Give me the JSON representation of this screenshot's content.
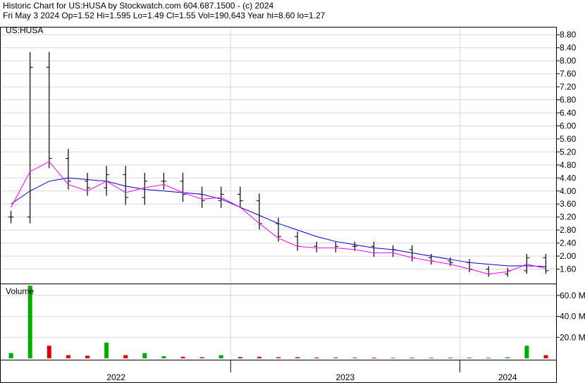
{
  "header": {
    "line1": "Historic Chart for US:HUSA by Stockwatch.com 604.687.1500 - (c) 2024",
    "line2": "Fri May  3 2024  Op=1.52  Hi=1.595  Lo=1.49  Cl=1.55  Vol=190,643  Year hi=8.60  lo=1.27"
  },
  "colors": {
    "price_bar": "#000000",
    "ma_short": "#ff00ff",
    "ma_long": "#0000cc",
    "volume_up": "#00aa00",
    "volume_down": "#dd0000",
    "grid": "#d8d8d8"
  },
  "chart_data": [
    {
      "type": "ohlc",
      "title": "US:HUSA",
      "ylim": [
        1.2,
        9.0
      ],
      "y_ticks": [
        "8.80",
        "8.40",
        "8.00",
        "7.60",
        "7.20",
        "6.80",
        "6.40",
        "6.00",
        "5.60",
        "5.20",
        "4.80",
        "4.40",
        "4.00",
        "3.60",
        "3.20",
        "2.80",
        "2.40",
        "2.00",
        "1.60"
      ],
      "x_ticks": [
        "2022",
        "2023",
        "2024"
      ],
      "grid": true,
      "series": [
        {
          "type": "price",
          "x": [
            "2022-01",
            "2022-02",
            "2022-03",
            "2022-04",
            "2022-05",
            "2022-06",
            "2022-07",
            "2022-08",
            "2022-09",
            "2022-10",
            "2022-11",
            "2022-12",
            "2023-01",
            "2023-02",
            "2023-03",
            "2023-04",
            "2023-05",
            "2023-06",
            "2023-07",
            "2023-08",
            "2023-09",
            "2023-10",
            "2023-11",
            "2023-12",
            "2024-01",
            "2024-02",
            "2024-03",
            "2024-04",
            "2024-05"
          ],
          "values": [
            3.2,
            7.8,
            5.0,
            4.3,
            4.1,
            4.5,
            3.8,
            4.3,
            4.3,
            3.9,
            3.7,
            3.9,
            3.7,
            3.0,
            2.6,
            2.3,
            2.25,
            2.3,
            2.3,
            2.1,
            2.2,
            1.95,
            1.85,
            1.8,
            1.6,
            1.45,
            1.55,
            1.95,
            1.55
          ]
        },
        {
          "type": "moving-average-short",
          "values": [
            3.5,
            4.6,
            4.9,
            4.2,
            4.0,
            4.3,
            3.95,
            4.1,
            4.2,
            3.95,
            3.75,
            3.8,
            3.5,
            3.0,
            2.55,
            2.3,
            2.25,
            2.25,
            2.2,
            2.1,
            2.1,
            1.95,
            1.85,
            1.75,
            1.6,
            1.45,
            1.52,
            1.75,
            1.62
          ]
        },
        {
          "type": "moving-average-long",
          "values": [
            3.6,
            4.0,
            4.3,
            4.4,
            4.35,
            4.3,
            4.15,
            4.05,
            4.0,
            3.95,
            3.9,
            3.75,
            3.5,
            3.25,
            3.0,
            2.8,
            2.6,
            2.45,
            2.35,
            2.25,
            2.2,
            2.1,
            2.0,
            1.9,
            1.8,
            1.75,
            1.7,
            1.7,
            1.68
          ]
        }
      ]
    },
    {
      "type": "bar",
      "title": "Volume",
      "ylim": [
        0,
        70000000
      ],
      "y_ticks": [
        "60.0 M",
        "40.0 M",
        "20.0 M"
      ],
      "x": [
        "2022-01",
        "2022-02",
        "2022-03",
        "2022-04",
        "2022-05",
        "2022-06",
        "2022-07",
        "2022-08",
        "2022-09",
        "2022-10",
        "2022-11",
        "2022-12",
        "2023-01",
        "2023-02",
        "2023-03",
        "2023-04",
        "2023-05",
        "2023-06",
        "2023-07",
        "2023-08",
        "2023-09",
        "2023-10",
        "2023-11",
        "2023-12",
        "2024-01",
        "2024-02",
        "2024-03",
        "2024-04",
        "2024-05"
      ],
      "values": [
        5000000,
        75000000,
        12000000,
        3000000,
        2500000,
        15000000,
        3000000,
        5000000,
        2000000,
        1500000,
        1000000,
        3000000,
        1200000,
        1500000,
        1000000,
        1000000,
        800000,
        900000,
        800000,
        700000,
        600000,
        600000,
        500000,
        500000,
        500000,
        500000,
        900000,
        12000000,
        3000000
      ]
    }
  ]
}
